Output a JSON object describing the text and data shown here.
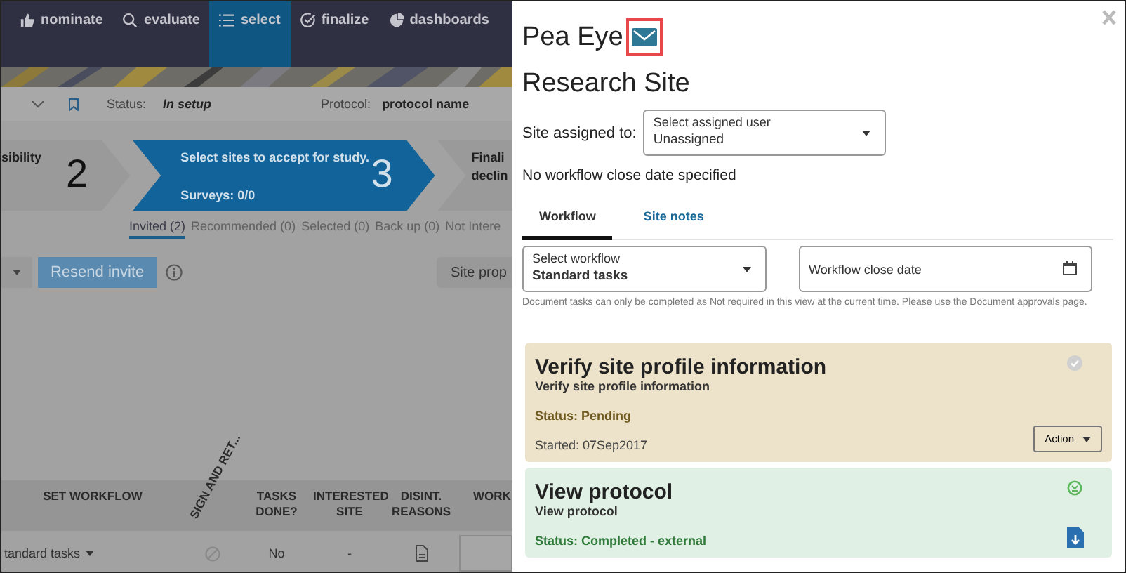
{
  "nav": [
    {
      "label": "nominate",
      "selected": false
    },
    {
      "label": "evaluate",
      "selected": false
    },
    {
      "label": "select",
      "selected": true
    },
    {
      "label": "finalize",
      "selected": false
    },
    {
      "label": "dashboards",
      "selected": false
    }
  ],
  "header": {
    "status_label": "Status:",
    "status": "In setup",
    "protocol_label": "Protocol:",
    "protocol": "protocol name"
  },
  "steps": [
    {
      "lines": [
        "sibility"
      ],
      "number": "2",
      "selected": false
    },
    {
      "lines": [
        "Select sites to accept for study."
      ],
      "subtext": "Surveys: 0/0",
      "number": "3",
      "selected": true
    },
    {
      "lines": [
        "Finali",
        "declin"
      ],
      "selected": false
    }
  ],
  "tabs": [
    {
      "label": "Invited (2)",
      "selected": true
    },
    {
      "label": "Recommended (0)",
      "selected": false
    },
    {
      "label": "Selected (0)",
      "selected": false
    },
    {
      "label": "Back up (0)",
      "selected": false
    },
    {
      "label": "Not Intere",
      "selected": false
    }
  ],
  "toolbar": {
    "resend": "Resend invite",
    "site_profile": "Site prop"
  },
  "table": {
    "columns": [
      "SET WORKFLOW",
      "SIGN AND RET...",
      "TASKS DONE?",
      "INTERESTED SITE",
      "DISINT. REASONS",
      "WORK"
    ],
    "rows": [
      {
        "workflow": "tandard tasks",
        "tasks_done": "No",
        "interested": "-"
      }
    ]
  },
  "drawer": {
    "name": "Pea Eye",
    "role": "Research Site",
    "assigned_label": "Site assigned to:",
    "assigned_select": {
      "label": "Select assigned user",
      "value": "Unassigned"
    },
    "close_date_note": "No workflow close date specified",
    "tabs": [
      {
        "label": "Workflow",
        "selected": true
      },
      {
        "label": "Site notes",
        "selected": false
      }
    ],
    "workflow_select": {
      "label": "Select workflow",
      "value": "Standard tasks"
    },
    "close_date_field": {
      "placeholder": "Workflow close date"
    },
    "hint": "Document tasks can only be completed as Not required in this view at the current time. Please use the Document approvals page.",
    "tasks": [
      {
        "title": "Verify site profile information",
        "subtitle": "Verify site profile information",
        "status": "Status: Pending",
        "kind": "pending",
        "started": "Started: 07Sep2017",
        "action": "Action"
      },
      {
        "title": "View protocol",
        "subtitle": "View protocol",
        "status": "Status: Completed - external",
        "kind": "completed"
      }
    ]
  }
}
